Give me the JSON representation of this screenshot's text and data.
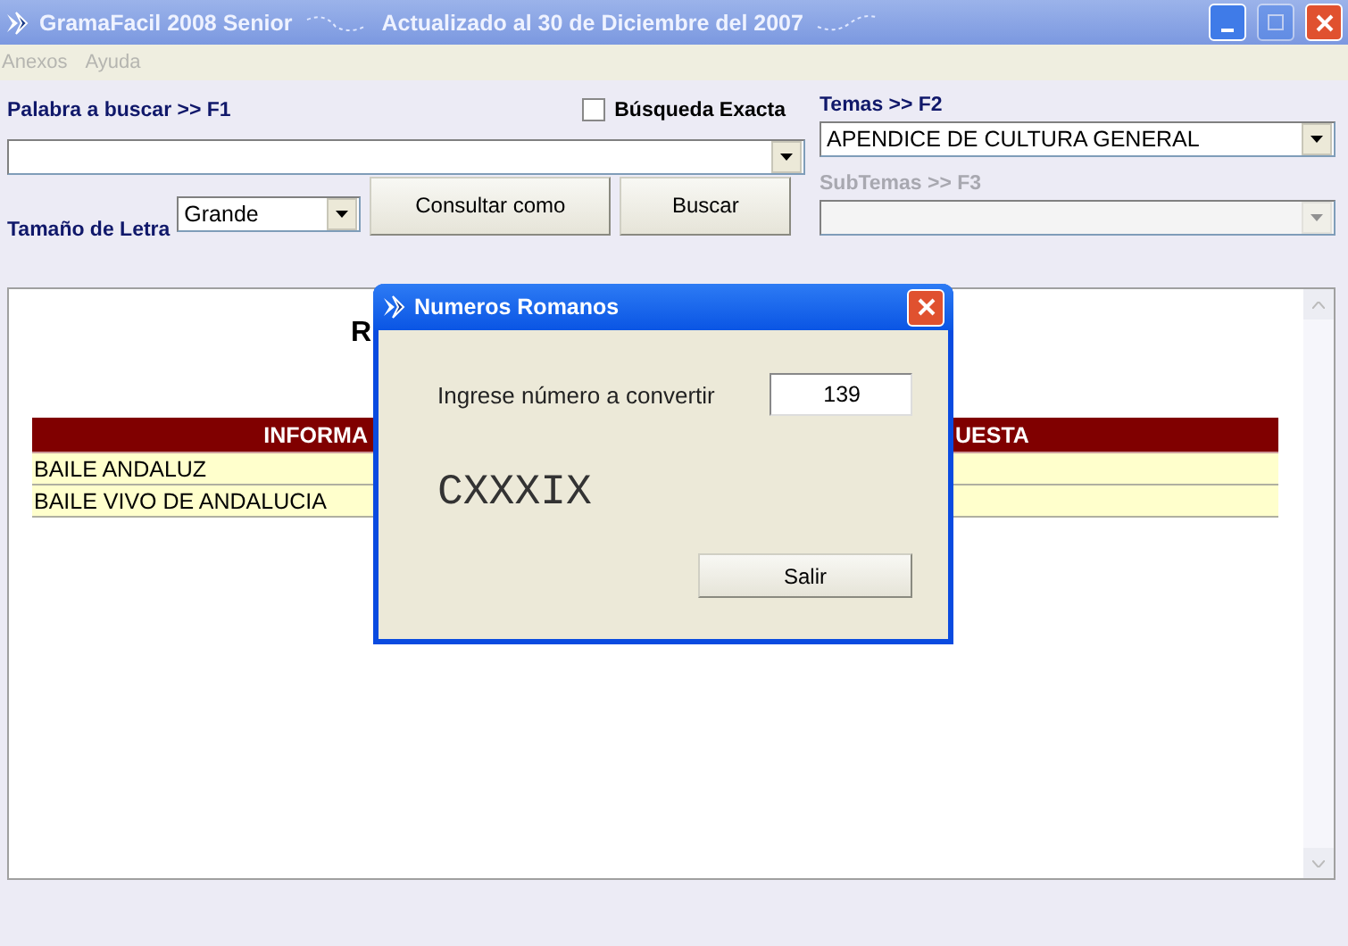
{
  "window": {
    "title": "GramaFacil 2008 Senior",
    "subtitle": "Actualizado al 30 de Diciembre del 2007",
    "maximize_disabled": true
  },
  "menu": [
    {
      "label": "Anexos",
      "disabled": true
    },
    {
      "label": "Ayuda",
      "disabled": true
    }
  ],
  "search": {
    "label": "Palabra a buscar >> F1"
  },
  "exact": {
    "label": "Búsqueda Exacta",
    "checked": false
  },
  "font_size": {
    "label": "Tamaño de Letra",
    "value": "Grande"
  },
  "buttons": [
    {
      "label": "Consultar como"
    },
    {
      "label": "Buscar"
    }
  ],
  "topics": {
    "label": "Temas >> F2",
    "value": "APENDICE DE CULTURA GENERAL",
    "disabled": false
  },
  "subtopics": {
    "label": "SubTemas >> F3",
    "disabled": true
  },
  "result": {
    "heading": "R",
    "columns": [
      "INFORMA",
      "UESTA"
    ],
    "rows": [
      [
        "BAILE ANDALUZ"
      ],
      [
        "BAILE VIVO DE ANDALUCIA"
      ]
    ]
  },
  "dialog": {
    "title": "Numeros Romanos",
    "prompt": "Ingrese número a convertir",
    "value": "139",
    "output": "CXXXIX",
    "button": "Salir"
  }
}
